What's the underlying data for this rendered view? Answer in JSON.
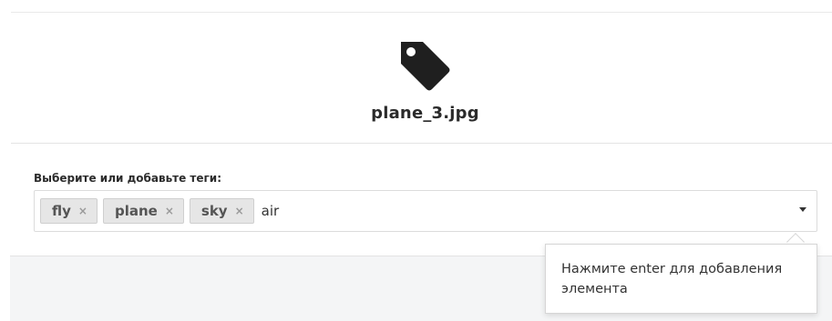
{
  "file": {
    "icon": "tag-icon",
    "name": "plane_3.jpg"
  },
  "tags_field": {
    "label": "Выберите или добавьте теги:",
    "chips": [
      {
        "label": "fly",
        "remove": "×"
      },
      {
        "label": "plane",
        "remove": "×"
      },
      {
        "label": "sky",
        "remove": "×"
      }
    ],
    "input_value": "air",
    "dropdown_icon": "caret-down-icon"
  },
  "tooltip": {
    "text": "Нажмите enter для добавления элемента"
  }
}
